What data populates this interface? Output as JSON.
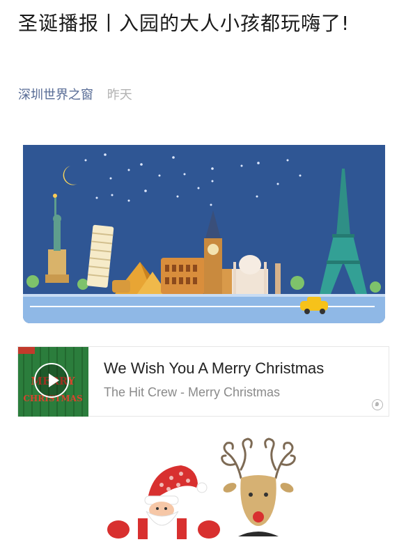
{
  "article": {
    "title": "圣诞播报丨入园的大人小孩都玩嗨了!",
    "author": "深圳世界之窗",
    "date": "昨天"
  },
  "music_card": {
    "song": "We Wish You A Merry Christmas",
    "singer": "The Hit Crew - Merry Christmas",
    "cover_text_1": "MERRY",
    "cover_text_2": "CHRISTMAS"
  },
  "colors": {
    "author_link": "#576b95",
    "night_sky": "#2f5694",
    "road": "#8fb8e6"
  }
}
